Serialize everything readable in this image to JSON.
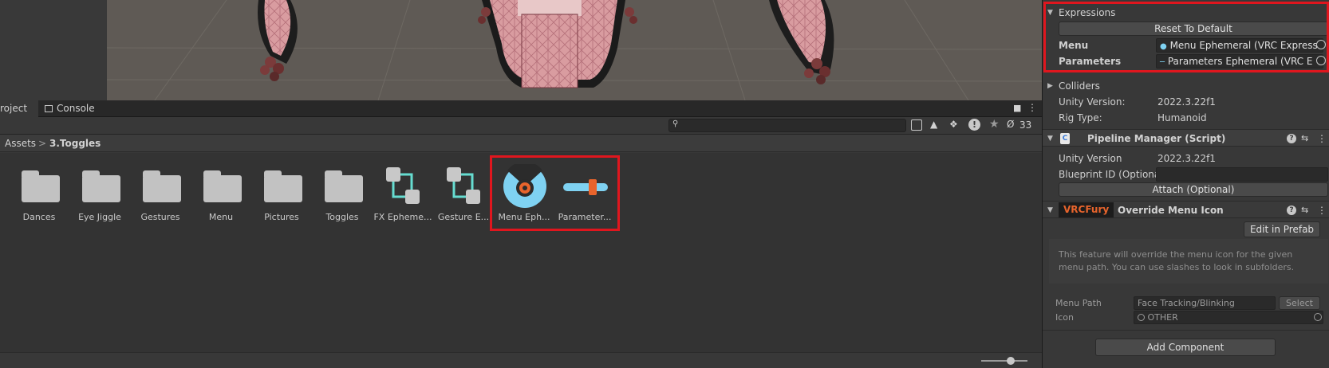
{
  "project": {
    "tabs": [
      {
        "label": "roject"
      },
      {
        "label": "Console"
      }
    ],
    "hidden_count": "33",
    "breadcrumb": {
      "root": "Assets",
      "separator": ">",
      "current": "3.Toggles"
    },
    "items": [
      {
        "label": "Dances",
        "type": "folder"
      },
      {
        "label": "Eye Jiggle",
        "type": "folder"
      },
      {
        "label": "Gestures",
        "type": "folder"
      },
      {
        "label": "Menu",
        "type": "folder"
      },
      {
        "label": "Pictures",
        "type": "folder"
      },
      {
        "label": "Toggles",
        "type": "folder"
      },
      {
        "label": "FX Epheme...",
        "type": "animator"
      },
      {
        "label": "Gesture E...",
        "type": "animator"
      },
      {
        "label": "Menu Eph...",
        "type": "expressions-menu"
      },
      {
        "label": "Parameter...",
        "type": "expressions-parameters"
      }
    ]
  },
  "inspector": {
    "expressions": {
      "title": "Expressions",
      "reset_button": "Reset To Default",
      "menu_label": "Menu",
      "menu_value": "Menu Ephemeral (VRC Express",
      "parameters_label": "Parameters",
      "parameters_value": "Parameters Ephemeral (VRC E"
    },
    "colliders_title": "Colliders",
    "unity_version_label": "Unity Version:",
    "unity_version_value": "2022.3.22f1",
    "rig_type_label": "Rig Type:",
    "rig_type_value": "Humanoid",
    "pipeline": {
      "title": "Pipeline Manager (Script)",
      "unity_version_label": "Unity Version",
      "unity_version_value": "2022.3.22f1",
      "blueprint_label": "Blueprint ID (Optional",
      "attach_button": "Attach (Optional)"
    },
    "vrcfury": {
      "badge": "VRCFury",
      "title": "Override Menu Icon",
      "edit_button": "Edit in Prefab",
      "description": "This feature will override the menu icon for the given menu path. You can use slashes to look in subfolders.",
      "menu_path_label": "Menu Path",
      "menu_path_value": "Face Tracking/Blinking",
      "select_button": "Select",
      "icon_label": "Icon",
      "icon_value": "OTHER"
    },
    "add_component_button": "Add Component"
  },
  "colors": {
    "highlight": "#e0161e",
    "accent_orange": "#e8642c",
    "menu_icon_blue": "#7fd2f2"
  }
}
